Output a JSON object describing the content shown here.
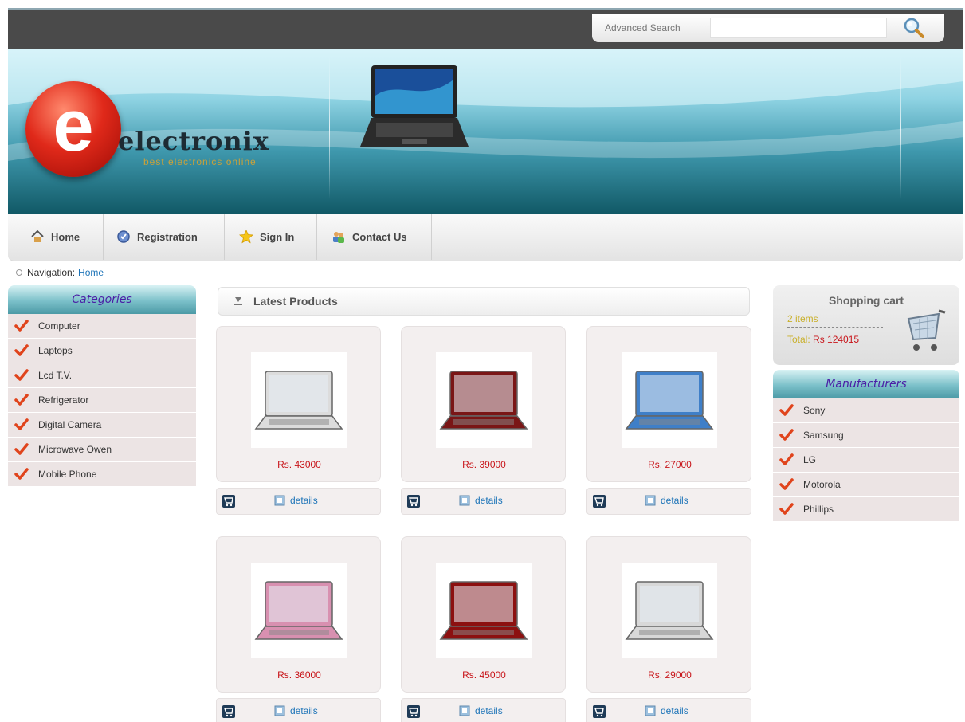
{
  "search": {
    "label": "Advanced Search",
    "value": "",
    "placeholder": ""
  },
  "brand": {
    "name": "electronix",
    "letter": "e",
    "tagline": "best electronics online"
  },
  "nav": [
    {
      "label": "Home"
    },
    {
      "label": "Registration"
    },
    {
      "label": "Sign In"
    },
    {
      "label": "Contact Us"
    }
  ],
  "breadcrumb": {
    "prefix": "Navigation:",
    "current": "Home"
  },
  "categories": {
    "title": "Categories",
    "items": [
      "Computer",
      "Laptops",
      "Lcd T.V.",
      "Refrigerator",
      "Digital Camera",
      "Microwave Owen",
      "Mobile Phone"
    ]
  },
  "latest": {
    "title": "Latest Products"
  },
  "products": [
    {
      "price": "Rs. 43000",
      "color": "#dcdcdc",
      "details": "details"
    },
    {
      "price": "Rs. 39000",
      "color": "#7a1616",
      "details": "details"
    },
    {
      "price": "Rs. 27000",
      "color": "#3f7fc8",
      "details": "details"
    },
    {
      "price": "Rs. 36000",
      "color": "#d890b0",
      "details": "details"
    },
    {
      "price": "Rs. 45000",
      "color": "#8c1010",
      "details": "details"
    },
    {
      "price": "Rs. 29000",
      "color": "#d8d8d8",
      "details": "details"
    }
  ],
  "cart": {
    "title": "Shopping cart",
    "items": "2 items",
    "total_label": "Total:",
    "total_value": "Rs 124015"
  },
  "manufacturers": {
    "title": "Manufacturers",
    "items": [
      "Sony",
      "Samsung",
      "LG",
      "Motorola",
      "Phillips"
    ]
  },
  "colors": {
    "accent_red": "#c8151a",
    "link_blue": "#1d74b8",
    "header_purple": "#4a1ea6",
    "check_red": "#e0441c"
  }
}
